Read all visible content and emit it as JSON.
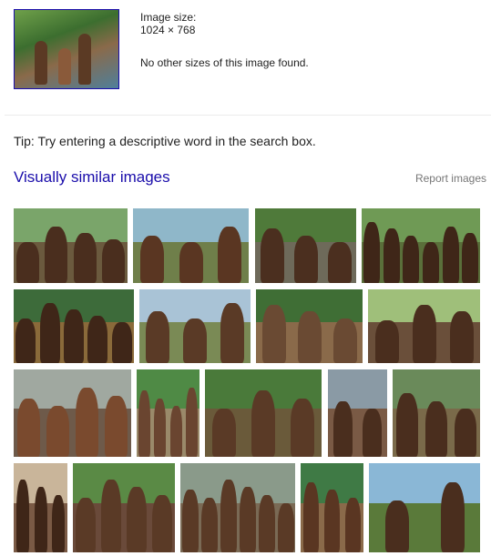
{
  "query_image": {
    "size_label": "Image size:",
    "size_value": "1024 × 768",
    "no_other_sizes": "No other sizes of this image found."
  },
  "tip": "Tip: Try entering a descriptive word in the search box.",
  "similar": {
    "title": "Visually similar images",
    "report_label": "Report images",
    "thumbnails": [
      {
        "sky": "#7aa56a",
        "ground": "#6b5a3e",
        "skin": "#4a2e1e",
        "people": 4
      },
      {
        "sky": "#8fb7c9",
        "ground": "#6f7f4a",
        "skin": "#5a3622",
        "people": 3
      },
      {
        "sky": "#4f7a3a",
        "ground": "#6e6a5a",
        "skin": "#4b2f1f",
        "people": 3
      },
      {
        "sky": "#6f9a55",
        "ground": "#5a6f3a",
        "skin": "#3f2618",
        "people": 6
      },
      {
        "sky": "#3d6b3a",
        "ground": "#8a6a3a",
        "skin": "#3f2618",
        "people": 5
      },
      {
        "sky": "#a9c3d6",
        "ground": "#7a8a55",
        "skin": "#5a3a26",
        "people": 3
      },
      {
        "sky": "#3f6e35",
        "ground": "#8a6a4a",
        "skin": "#6a4a33",
        "people": 3
      },
      {
        "sky": "#9fbf7a",
        "ground": "#6a4f3a",
        "skin": "#4a2e1e",
        "people": 3
      },
      {
        "sky": "#a0a8a0",
        "ground": "#6e5a4a",
        "skin": "#7a4a2e",
        "people": 4
      },
      {
        "sky": "#4f8a45",
        "ground": "#9a8a6a",
        "skin": "#6a4530",
        "people": 4
      },
      {
        "sky": "#4a7a3a",
        "ground": "#6a5a3a",
        "skin": "#5a3a26",
        "people": 3
      },
      {
        "sky": "#8a9aa5",
        "ground": "#7a5a45",
        "skin": "#4a2e1e",
        "people": 2
      },
      {
        "sky": "#6a8a5a",
        "ground": "#7a6a4a",
        "skin": "#4a2e1e",
        "people": 3
      },
      {
        "sky": "#c9b59a",
        "ground": "#7a5a45",
        "skin": "#3f2618",
        "people": 3
      },
      {
        "sky": "#5a8a45",
        "ground": "#6a4a3a",
        "skin": "#5a3a26",
        "people": 4
      },
      {
        "sky": "#8a9a8a",
        "ground": "#7a6a55",
        "skin": "#5a3a26",
        "people": 6
      },
      {
        "sky": "#3f7a45",
        "ground": "#8a6a4a",
        "skin": "#5a3622",
        "people": 3
      },
      {
        "sky": "#8ab7d6",
        "ground": "#5a7a3a",
        "skin": "#4a2e1e",
        "people": 2
      }
    ]
  }
}
